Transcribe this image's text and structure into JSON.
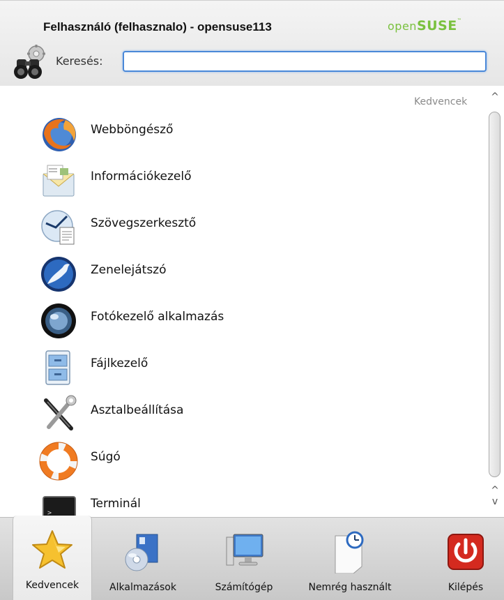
{
  "header": {
    "title": "Felhasználó (felhasznalo) - opensuse113",
    "brand_open": "open",
    "brand_suse": "SUSE",
    "brand_mark": "™"
  },
  "search": {
    "label": "Keresés:",
    "value": "",
    "placeholder": ""
  },
  "favorites": {
    "section_label": "Kedvencek",
    "items": [
      {
        "label": "Webböngésző",
        "icon": "firefox-icon"
      },
      {
        "label": "Információkezelő",
        "icon": "mail-info-icon"
      },
      {
        "label": "Szövegszerkesztő",
        "icon": "text-editor-icon"
      },
      {
        "label": "Zenelejátszó",
        "icon": "music-player-icon"
      },
      {
        "label": "Fotókezelő alkalmazás",
        "icon": "photo-manager-icon"
      },
      {
        "label": "Fájlkezelő",
        "icon": "file-manager-icon"
      },
      {
        "label": "Asztalbeállítása",
        "icon": "settings-tools-icon"
      },
      {
        "label": "Súgó",
        "icon": "help-lifebuoy-icon"
      },
      {
        "label": "Terminál",
        "icon": "terminal-icon"
      }
    ]
  },
  "scroll": {
    "up": "^",
    "down": "v"
  },
  "tabs": [
    {
      "label": "Kedvencek",
      "active": true
    },
    {
      "label": "Alkalmazások"
    },
    {
      "label": "Számítógép"
    },
    {
      "label": "Nemrég használt"
    },
    {
      "label": "Kilépés"
    }
  ],
  "colors": {
    "brand_green": "#7ac13e",
    "search_border": "#4a88d8",
    "logout_red": "#d42a1f"
  }
}
